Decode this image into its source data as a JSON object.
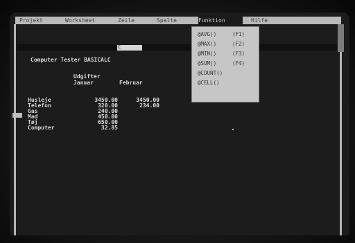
{
  "menubar": {
    "items": [
      {
        "label": "Projekt",
        "active": false
      },
      {
        "label": "Worksheet",
        "active": false
      },
      {
        "label": "Zeile",
        "active": false
      },
      {
        "label": "Spalte",
        "active": false
      },
      {
        "label": "Funktion",
        "active": true
      },
      {
        "label": "Hilfe",
        "active": false
      }
    ]
  },
  "cell_indicator": "C",
  "sheet": {
    "title": "Computer Tester BASICALC",
    "header_label": "Udgifter",
    "col1_header": "Januar",
    "col2_header": "Februar",
    "rows": [
      {
        "label": "Husleje",
        "jan": "3450.00",
        "feb": "3450.00"
      },
      {
        "label": "Telefon",
        "jan": "320.00",
        "feb": "234.00"
      },
      {
        "label": "Gas",
        "jan": "240.00",
        "feb": ""
      },
      {
        "label": "Mad",
        "jan": "450.00",
        "feb": ""
      },
      {
        "label": "Tøj",
        "jan": "650.00",
        "feb": ""
      },
      {
        "label": "Computer",
        "jan": "32.85",
        "feb": ""
      }
    ]
  },
  "function_menu": {
    "items": [
      {
        "label": "@AVG()",
        "key": "(F1)"
      },
      {
        "label": "@MAX()",
        "key": "(F2)"
      },
      {
        "label": "@MIN()",
        "key": "(F3)"
      },
      {
        "label": "@SUM()",
        "key": "(F4)"
      },
      {
        "label": "@COUNT()",
        "key": ""
      },
      {
        "label": "@CELL()",
        "key": ""
      }
    ]
  }
}
